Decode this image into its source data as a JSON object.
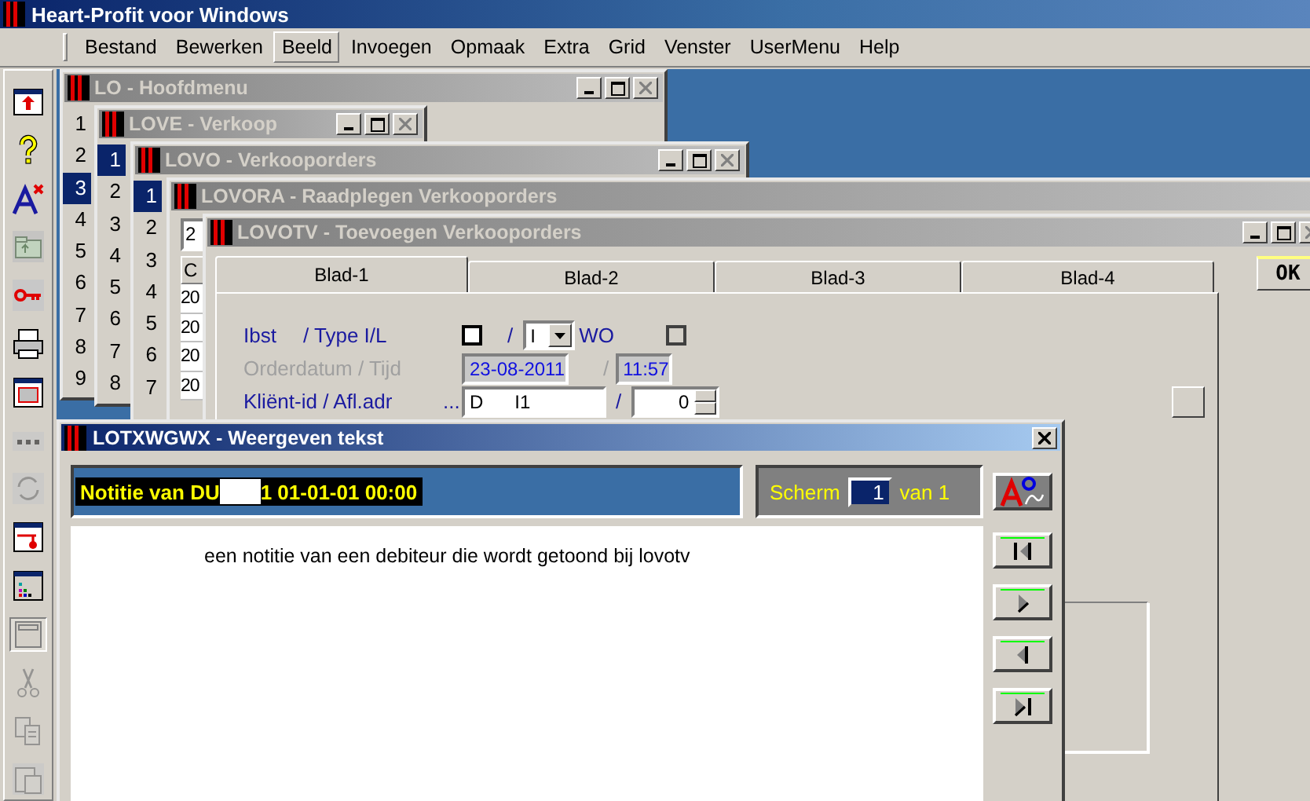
{
  "app_title": "Heart-Profit voor Windows",
  "menu": [
    {
      "label": "Bestand",
      "selected": false
    },
    {
      "label": "Bewerken",
      "selected": false
    },
    {
      "label": "Beeld",
      "selected": true
    },
    {
      "label": "Invoegen",
      "selected": false
    },
    {
      "label": "Opmaak",
      "selected": false
    },
    {
      "label": "Extra",
      "selected": false
    },
    {
      "label": "Grid",
      "selected": false
    },
    {
      "label": "Venster",
      "selected": false
    },
    {
      "label": "UserMenu",
      "selected": false
    },
    {
      "label": "Help",
      "selected": false
    }
  ],
  "toolbar": [
    {
      "disabled": false,
      "pressed": false
    },
    {
      "disabled": false,
      "pressed": false
    },
    {
      "disabled": false,
      "pressed": false
    },
    {
      "disabled": true,
      "pressed": false
    },
    {
      "disabled": false,
      "pressed": false
    },
    {
      "disabled": false,
      "pressed": false
    },
    {
      "disabled": false,
      "pressed": false
    },
    {
      "disabled": true,
      "pressed": false
    },
    {
      "disabled": true,
      "pressed": false
    },
    {
      "disabled": false,
      "pressed": false
    },
    {
      "disabled": false,
      "pressed": false
    },
    {
      "disabled": false,
      "pressed": true
    },
    {
      "disabled": true,
      "pressed": false
    },
    {
      "disabled": true,
      "pressed": false
    },
    {
      "disabled": true,
      "pressed": false
    }
  ],
  "hoofdmenu": {
    "title": "LO - Hoofdmenu",
    "rows": [
      {
        "label": "1",
        "selected": false
      },
      {
        "label": "2",
        "selected": false
      },
      {
        "label": "3",
        "selected": true
      },
      {
        "label": "4",
        "selected": false
      },
      {
        "label": "5",
        "selected": false
      },
      {
        "label": "6",
        "selected": false
      },
      {
        "label": "7",
        "selected": false
      },
      {
        "label": "8",
        "selected": false
      },
      {
        "label": "9",
        "selected": false
      }
    ]
  },
  "verkoop": {
    "title": "LOVE - Verkoop",
    "rows": [
      {
        "label": "1",
        "selected": true
      },
      {
        "label": "2",
        "selected": false
      },
      {
        "label": "3",
        "selected": false
      },
      {
        "label": "4",
        "selected": false
      },
      {
        "label": "5",
        "selected": false
      },
      {
        "label": "6",
        "selected": false
      },
      {
        "label": "7",
        "selected": false
      },
      {
        "label": "8",
        "selected": false
      }
    ]
  },
  "verkooporders": {
    "title": "LOVO - Verkooporders",
    "rows": [
      {
        "label": "1",
        "selected": true
      },
      {
        "label": "2",
        "selected": false
      },
      {
        "label": "3",
        "selected": false
      },
      {
        "label": "4",
        "selected": false
      },
      {
        "label": "5",
        "selected": false
      },
      {
        "label": "6",
        "selected": false
      },
      {
        "label": "7",
        "selected": false
      }
    ]
  },
  "raadplegen": {
    "title": "LOVORA - Raadplegen Verkooporders",
    "field": "2",
    "column_1": "C",
    "cells": [
      "20",
      "20",
      "20",
      "20"
    ]
  },
  "toevoegen": {
    "title": "LOVOTV - Toevoegen Verkooporders",
    "tabs": [
      {
        "label": "Blad-1",
        "selected": true
      },
      {
        "label": "Blad-2",
        "selected": false
      },
      {
        "label": "Blad-3",
        "selected": false
      },
      {
        "label": "Blad-4",
        "selected": false
      }
    ],
    "ibst_label": "Ibst",
    "type_label": "/ Type I/L",
    "ibst_checked": false,
    "slash_1": "/",
    "type_value": "I",
    "wo_label": "WO",
    "wo_checked": false,
    "orderdatum_label": "Orderdatum / Tijd",
    "orderdatum_disabled": true,
    "orderdatum": "23-08-2011",
    "slash_2": "/",
    "tijd": "11:57",
    "klient_label": "Kliënt-id / Afl.adr",
    "ellipsis": "...",
    "klient_id": "D      I1",
    "slash_3": "/",
    "afl_adr": "0",
    "ok_button": "OK"
  },
  "text_window": {
    "title": "LOTXWGWX - Weergeven tekst",
    "header_start": "Notitie van DU",
    "header_end": "1 01-01-01 00:00",
    "screen_label": "Scherm",
    "screen_value": "1",
    "screen_total": "van 1",
    "body": "een notitie van een debiteur die wordt getoond bij lovotv"
  }
}
